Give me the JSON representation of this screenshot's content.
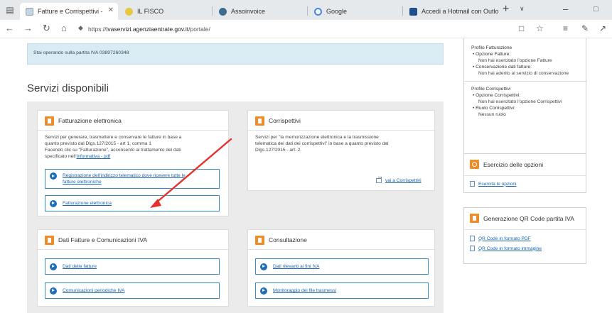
{
  "colors": {
    "accent_orange": "#f08c28",
    "link_blue": "#1a66b0",
    "banner_bg": "#d9ecf4",
    "panel_bg": "#ebebeb",
    "annotation_red": "#e5322d"
  },
  "browser": {
    "tabs": [
      {
        "label": "Fatture e Corrispettivi -",
        "icon": "document-icon",
        "active": true
      },
      {
        "label": "IL FISCO",
        "icon": "ilfisco-icon",
        "active": false
      },
      {
        "label": "Assoinvoice",
        "icon": "assoinvoice-icon",
        "active": false
      },
      {
        "label": "Google",
        "icon": "google-icon",
        "active": false
      },
      {
        "label": "Accedi a Hotmail con Outlo",
        "icon": "outlook-icon",
        "active": false
      }
    ],
    "address_protocol": "https://",
    "address_host": "ivaservizi.agenziaentrate.gov.it",
    "address_path": "/portale/"
  },
  "page": {
    "vat_banner": "Stai operando sulla partita IVA 03897260348",
    "section_title": "Servizi disponibili",
    "cards": {
      "fatturazione": {
        "title": "Fatturazione elettronica",
        "desc_line1": "Servizi per generare, trasmettere e conservare le fatture in base a",
        "desc_line2": "quanto previsto dal Dlgs.127/2015 - art 1, comma 1",
        "desc_line3": "Facendo clic su \"Fatturazione\", acconsento al trattamento dei dati",
        "desc_line4_prefix": "specificato nell'",
        "desc_line4_link": "Informativa - pdf",
        "link1_line1": "Registrazione dell'indirizzo telematico dove ricevere tutte le",
        "link1_line2": "fatture elettroniche",
        "link2": "Fatturazione elettronica"
      },
      "corrispettivi": {
        "title": "Corrispettivi",
        "desc_line1": "Servizi per \"la memorizzazione elettronica e la trasmissione",
        "desc_line2": "telematica dei dati dei corrispettivi\" in base a quanto previsto dal",
        "desc_line3": "Dlgs.127/2015 - art. 2.",
        "link": "vai a Corrispettivi"
      },
      "dati_fatture": {
        "title": "Dati Fatture e Comunicazioni IVA",
        "link1": "Dati delle fatture",
        "link2": "Comunicazioni periodiche IVA"
      },
      "consultazione": {
        "title": "Consultazione",
        "link1": "Dati rilevanti ai fini IVA",
        "link2": "Monitoraggio dei file trasmessi"
      }
    }
  },
  "sidebar": {
    "profilo_fatturazione": {
      "heading": "Profilo Fatturazione",
      "item1": "Opzione Fatture:",
      "item1_value": "Non hai esercitato l'opzione Fatture",
      "item2": "Conservazione dati fatture:",
      "item2_value": "Non hai aderito al servizio di conservazione"
    },
    "profilo_corrispettivi": {
      "heading": "Profilo Corrispettivi",
      "item1": "Opzione Corrispettivi:",
      "item1_value": "Non hai esercitato l'opzione Corrispettivi",
      "item2": "Ruolo Corrispettivi:",
      "item2_value": "Nessun ruolo"
    },
    "esercizio": {
      "title": "Esercizio delle opzioni",
      "link": "Esercita le opzioni"
    },
    "qr": {
      "title": "Generazione QR Code partita IVA",
      "link1": "QR Code in formato PDF",
      "link2": "QR Code in formato immagine"
    }
  }
}
